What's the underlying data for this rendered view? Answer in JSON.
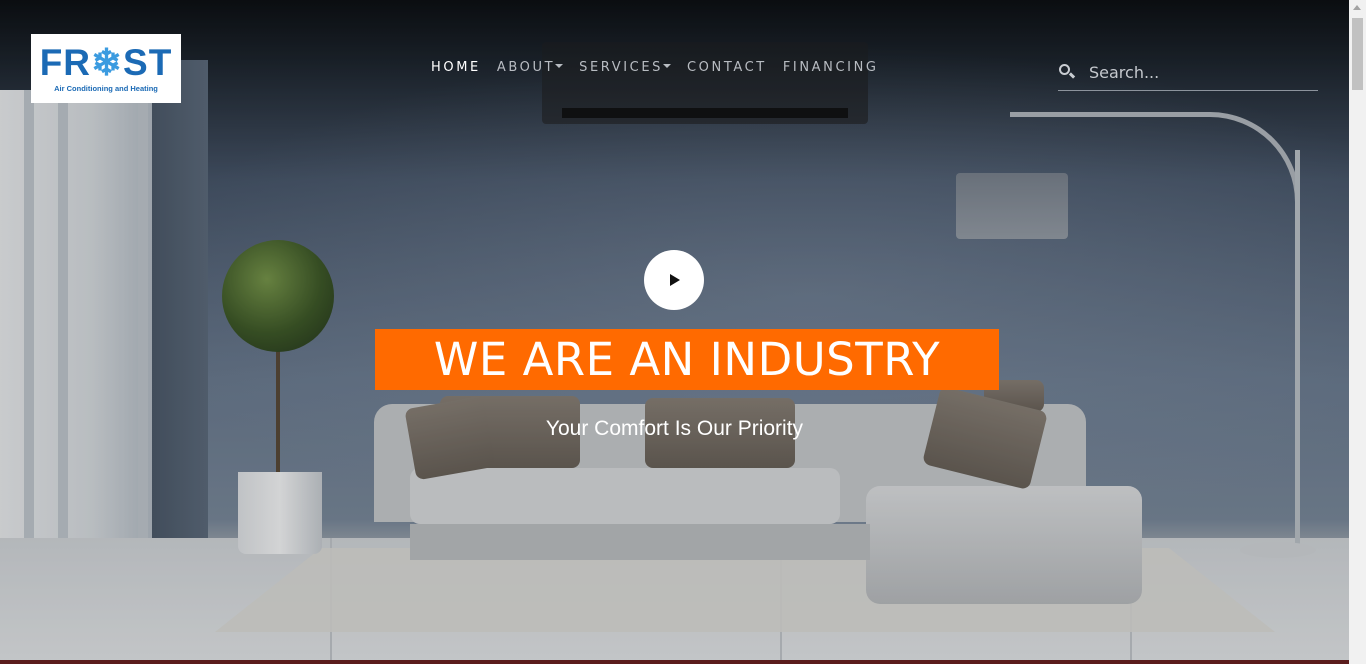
{
  "logo": {
    "word_left": "FR",
    "word_flake": "❄",
    "word_right": "ST",
    "tagline": "Air Conditioning and Heating"
  },
  "nav": {
    "items": [
      {
        "label": "HOME",
        "active": true,
        "dropdown": false
      },
      {
        "label": "ABOUT",
        "active": false,
        "dropdown": true
      },
      {
        "label": "SERVICES",
        "active": false,
        "dropdown": true
      },
      {
        "label": "CONTACT",
        "active": false,
        "dropdown": false
      },
      {
        "label": "FINANCING",
        "active": false,
        "dropdown": false
      }
    ]
  },
  "search": {
    "placeholder": "Search...",
    "icon": "search-icon"
  },
  "hero": {
    "play_icon": "play-icon",
    "headline": "WE ARE AN INDUSTRY",
    "subheadline": "Your Comfort Is Our Priority"
  },
  "colors": {
    "accent": "#ff6a00",
    "brand": "#1b6ab5"
  }
}
